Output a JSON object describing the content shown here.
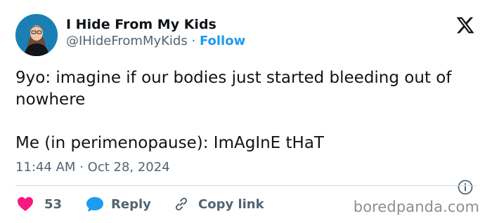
{
  "author": {
    "display_name": "I Hide From My Kids",
    "handle": "@IHideFromMyKids",
    "separator": "·",
    "follow_label": "Follow"
  },
  "tweet": {
    "text": "9yo: imagine if our bodies just started bleeding out of nowhere\n\nMe (in perimenopause): ImAgInE tHaT",
    "time": "11:44 AM",
    "date_separator": "·",
    "date": "Oct 28, 2024"
  },
  "actions": {
    "likes_count": "53",
    "reply_label": "Reply",
    "copy_link_label": "Copy link"
  },
  "watermark": "boredpanda.com",
  "icons": {
    "platform": "x-logo-icon",
    "info": "info-icon",
    "like": "heart-icon",
    "reply": "speech-bubble-icon",
    "copy_link": "link-icon"
  },
  "colors": {
    "like": "#f91880",
    "accent": "#1d9bf0",
    "text": "#0f1419",
    "muted": "#536471",
    "divider": "#cfd9de"
  }
}
